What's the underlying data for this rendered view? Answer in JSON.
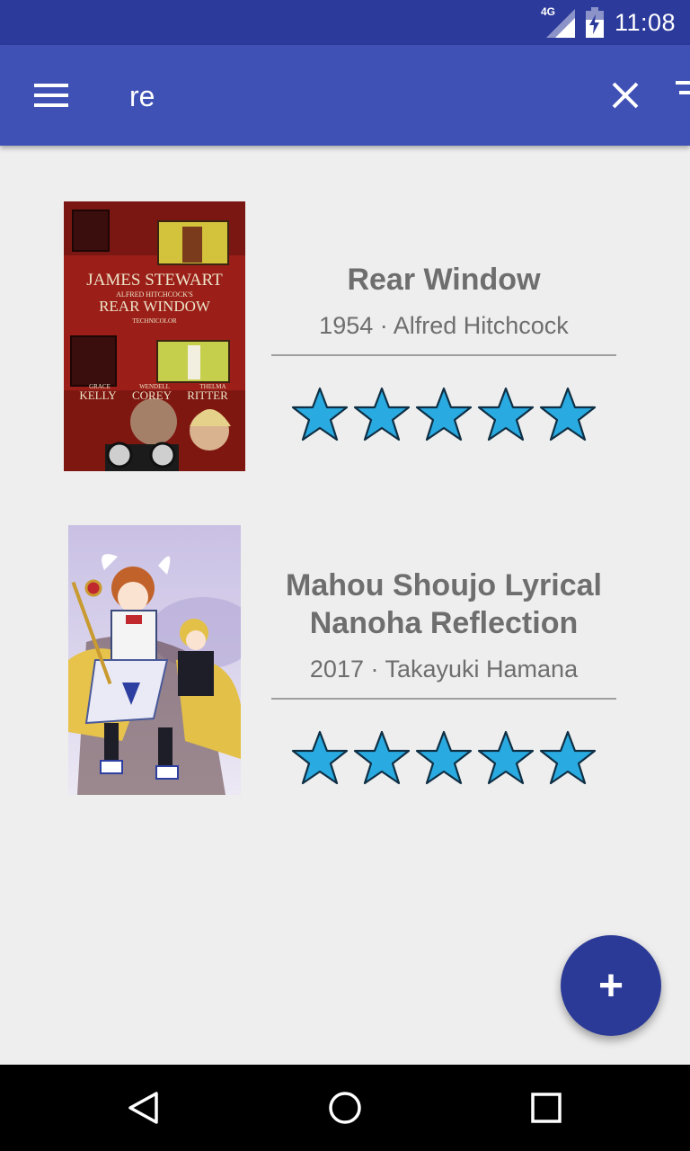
{
  "status_bar": {
    "network": "4G",
    "time": "11:08"
  },
  "search": {
    "query": "re"
  },
  "icons": {
    "menu": "hamburger-menu-icon",
    "close": "close-icon",
    "filter": "filter-list-icon",
    "add": "plus-icon",
    "back": "back-triangle-icon",
    "home": "home-circle-icon",
    "recents": "recents-square-icon"
  },
  "movies": [
    {
      "title": "Rear Window",
      "meta": "1954 · Alfred Hitchcock",
      "rating": 5,
      "rating_max": 5,
      "poster_text": [
        "JAMES STEWART",
        "ALFRED HITCHCOCK'S",
        "REAR WINDOW",
        "TECHNICOLOR",
        "GRACE",
        "WENDELL",
        "THELMA",
        "KELLY",
        "COREY",
        "RITTER"
      ]
    },
    {
      "title": "Mahou Shoujo Lyrical Nanoha Reflection",
      "meta": "2017 · Takayuki Hamana",
      "rating": 5,
      "rating_max": 5
    }
  ],
  "fab": {
    "label": "+"
  },
  "colors": {
    "status_bar": "#2c3a9c",
    "app_bar": "#3f51b5",
    "background": "#eeeeee",
    "text": "#6e6e6e",
    "star_fill": "#29abe2",
    "fab": "#2b3a97"
  }
}
